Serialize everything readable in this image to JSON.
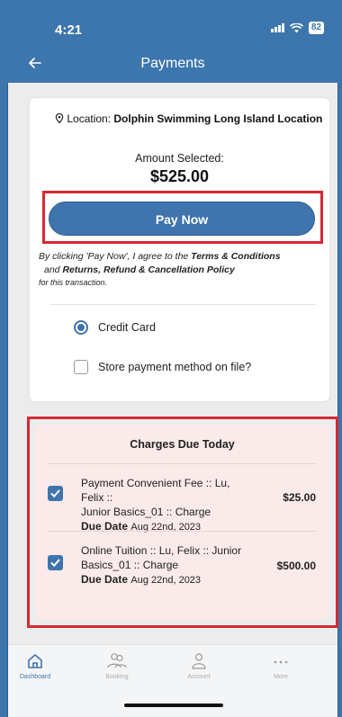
{
  "status_bar": {
    "time": "4:21",
    "battery": "82"
  },
  "header": {
    "title": "Payments"
  },
  "payment": {
    "location_prefix": "Location: ",
    "location_name": "Dolphin Swimming Long Island Location",
    "amount_label": "Amount Selected:",
    "amount": "$525.00",
    "pay_button": "Pay Now",
    "terms": {
      "line1_prefix": "By clicking 'Pay Now', I agree to the ",
      "terms_link": "Terms & Conditions",
      "and": "and ",
      "policy_link": "Returns, Refund & Cancellation Policy",
      "line3": "for this transaction."
    },
    "method_label": "Credit Card",
    "store_label": "Store payment method on file?"
  },
  "charges": {
    "title": "Charges Due Today",
    "due_label": "Due Date",
    "items": [
      {
        "line1": "Payment Convenient Fee :: Lu, Felix ::",
        "line2": "Junior Basics_01 :: Charge",
        "due": "Aug 22nd, 2023",
        "amount": "$25.00"
      },
      {
        "line1": "Online Tuition :: Lu, Felix :: Junior",
        "line2": "Basics_01 :: Charge",
        "due": "Aug 22nd, 2023",
        "amount": "$500.00"
      }
    ]
  },
  "nav": {
    "items": [
      {
        "label": "Dashboard",
        "icon": "home-icon",
        "active": true
      },
      {
        "label": "Booking",
        "icon": "group-icon",
        "active": false
      },
      {
        "label": "Account",
        "icon": "person-icon",
        "active": false
      },
      {
        "label": "More",
        "icon": "more-icon",
        "active": false
      }
    ]
  },
  "colors": {
    "primary": "#3d76ad",
    "highlight": "#d42a33",
    "charges_bg": "#fbeaea"
  }
}
